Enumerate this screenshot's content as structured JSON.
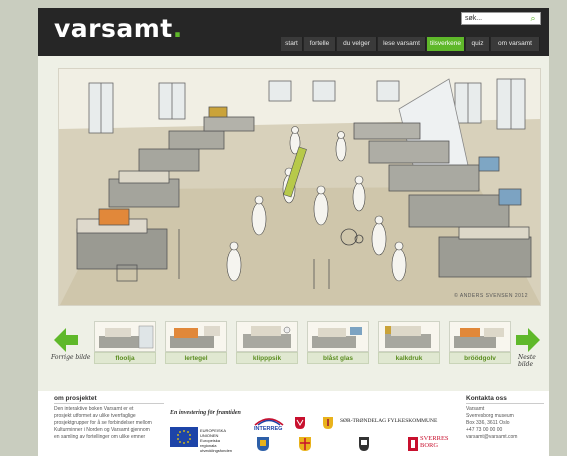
{
  "brand": {
    "name": "varsamt",
    "dot": ".",
    "accent": "#5fb82a"
  },
  "search": {
    "placeholder": "søk...",
    "icon": "search-icon"
  },
  "nav": [
    {
      "label": "start",
      "active": false
    },
    {
      "label": "fortelle",
      "active": false
    },
    {
      "label": "du velger",
      "active": false
    },
    {
      "label": "lese varsamt",
      "active": false
    },
    {
      "label": "tilsverkene",
      "active": true
    },
    {
      "label": "quiz",
      "active": false
    },
    {
      "label": "om varsamt",
      "active": false
    }
  ],
  "hero": {
    "credit": "© ANDERS SVENSEN 2012"
  },
  "carousel": {
    "prev_label": "Forrige bilde",
    "next_label": "Neste bilde",
    "items": [
      "floolja",
      "lertegel",
      "klipppsik",
      "blåst glas",
      "kalkdruk",
      "bröödgolv"
    ]
  },
  "footer": {
    "about_title": "om prosjektet",
    "about_text": [
      "Den interaktive boken Varsamt er et",
      "prosjekt utformet av ulike tverrfaglige",
      "prosjektgrupper for å se forbindelser mellom",
      "Kulturminner i Norden og Varsamt gjennom",
      "en samling av fortellinger om ulike emner"
    ],
    "investment_title": "En investering för framtiden",
    "eu_text": [
      "EUROPEISKA",
      "UNIONEN",
      "Europeiska",
      "regionala",
      "utvecklingsfonden"
    ],
    "logos": [
      "INTERREG",
      "SØR-TRØNDELAG FYLKESKOMMUNE",
      "SVERRES BORG"
    ],
    "contact_title": "Kontakta oss",
    "contact_text": [
      "Varsamt",
      "Sverresborg museum",
      "Box 336, 3611 Oslo",
      "+47 73 00 00 00",
      "varsamt@varsamt.com"
    ]
  }
}
